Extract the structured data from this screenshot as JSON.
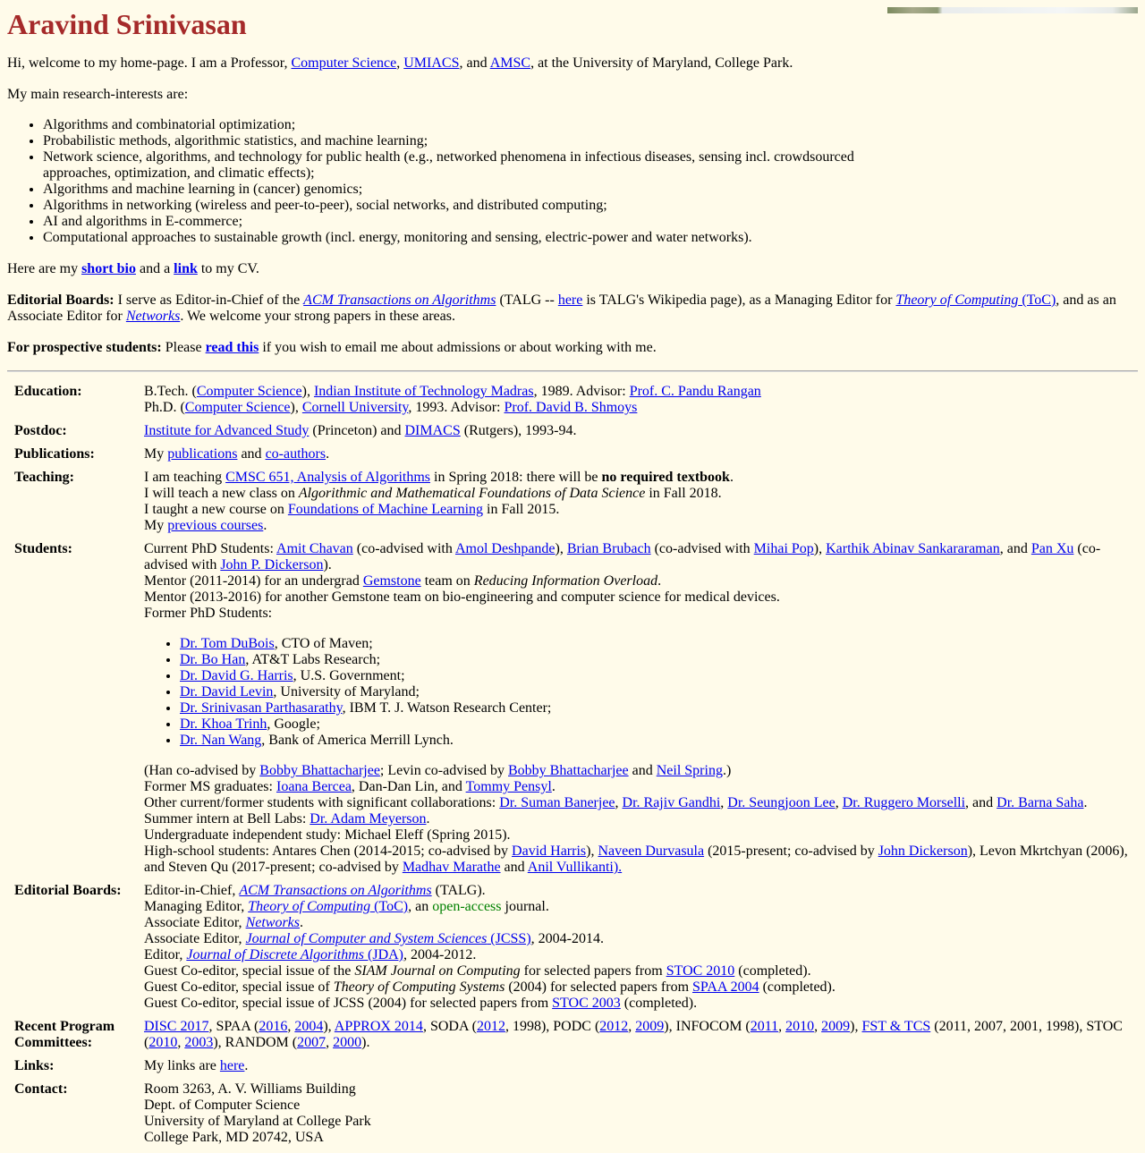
{
  "header": {
    "name": "Aravind Srinivasan"
  },
  "intro": {
    "t1": "Hi, welcome to my home-page. I am a Professor, ",
    "cs": "Computer Science",
    "sep1": ", ",
    "umiacs": "UMIACS",
    "sep2": ", and ",
    "amsc": "AMSC",
    "t2": ", at the University of Maryland, College Park."
  },
  "research": {
    "heading": "My main research-interests are:",
    "items": [
      "Algorithms and combinatorial optimization;",
      "Probabilistic methods, algorithmic statistics, and machine learning;",
      "Network science, algorithms, and technology for public health (e.g., networked phenomena in infectious diseases, sensing incl. crowdsourced approaches, optimization, and climatic effects);",
      "Algorithms and machine learning in (cancer) genomics;",
      "Algorithms in networking (wireless and peer-to-peer), social networks, and distributed computing;",
      "AI and algorithms in E-commerce;",
      "Computational approaches to sustainable growth (incl. energy, monitoring and sensing, electric-power and water networks)."
    ]
  },
  "bio": {
    "t1": "Here are my ",
    "short_bio": "short bio",
    "t2": " and a ",
    "link": "link",
    "t3": " to my CV."
  },
  "editorial_intro": {
    "label": "Editorial Boards:",
    "t1": " I serve as Editor-in-Chief of the ",
    "talg": "ACM Transactions on Algorithms",
    "t2": " (TALG -- ",
    "here": "here",
    "t3": " is TALG's Wikipedia page), as a Managing Editor for ",
    "toc": "Theory of Computing",
    "toc_abbr": " (ToC)",
    "t4": ", and as an Associate Editor for ",
    "networks": "Networks",
    "t5": ". We welcome your strong papers in these areas."
  },
  "prospective": {
    "label": "For prospective students:",
    "t1": " Please ",
    "read_this": "read this",
    "t2": " if you wish to email me about admissions or about working with me."
  },
  "table": {
    "education": {
      "label": "Education:",
      "l1_a": "B.Tech. (",
      "l1_cs": "Computer Science",
      "l1_b": "), ",
      "l1_iit": "Indian Institute of Technology Madras",
      "l1_c": ", 1989. Advisor: ",
      "l1_adv": "Prof. C. Pandu Rangan",
      "l2_a": "Ph.D. (",
      "l2_cs": "Computer Science",
      "l2_b": "), ",
      "l2_cornell": "Cornell University",
      "l2_c": ", 1993. Advisor: ",
      "l2_adv": "Prof. David B. Shmoys"
    },
    "postdoc": {
      "label": "Postdoc:",
      "ias": "Institute for Advanced Study",
      "t1": " (Princeton) and ",
      "dimacs": "DIMACS",
      "t2": " (Rutgers), 1993-94."
    },
    "publications": {
      "label": "Publications:",
      "t1": "My ",
      "pubs": "publications",
      "t2": " and ",
      "coauthors": "co-authors",
      "t3": "."
    },
    "teaching": {
      "label": "Teaching:",
      "l1_a": "I am teaching ",
      "l1_course": "CMSC 651, Analysis of Algorithms",
      "l1_b": " in Spring 2018: there will be ",
      "l1_bold": "no required textbook",
      "l1_c": ".",
      "l2_a": "I will teach a new class on ",
      "l2_em": "Algorithmic and Mathematical Foundations of Data Science",
      "l2_b": " in Fall 2018.",
      "l3_a": "I taught a new course on ",
      "l3_link": "Foundations of Machine Learning",
      "l3_b": " in Fall 2015.",
      "l4_a": "My ",
      "l4_link": "previous courses",
      "l4_b": "."
    },
    "students": {
      "label": "Students:",
      "cur_a": "Current PhD Students: ",
      "amit": "Amit Chavan",
      "cur_b": " (co-advised with ",
      "amol": "Amol Deshpande",
      "cur_c": "), ",
      "brian": "Brian Brubach",
      "cur_d": " (co-advised with ",
      "mihai": "Mihai Pop",
      "cur_e": "), ",
      "karthik": "Karthik Abinav Sankararaman",
      "cur_f": ", and ",
      "panxu": "Pan Xu",
      "cur_g": " (co-advised with ",
      "dickerson": "John P. Dickerson",
      "cur_h": ").",
      "m1_a": "Mentor (2011-2014) for an undergrad ",
      "gemstone": "Gemstone",
      "m1_b": " team on ",
      "m1_em": "Reducing Information Overload",
      "m1_c": ".",
      "m2": "Mentor (2013-2016) for another Gemstone team on bio-engineering and computer science for medical devices.",
      "former": "Former PhD Students:",
      "former_list": [
        {
          "name": "Dr. Tom DuBois",
          "rest": ", CTO of Maven;"
        },
        {
          "name": "Dr. Bo Han",
          "rest": ", AT&T Labs Research;"
        },
        {
          "name": "Dr. David G. Harris",
          "rest": ", U.S. Government;"
        },
        {
          "name": "Dr. David Levin",
          "rest": ", University of Maryland;"
        },
        {
          "name": "Dr. Srinivasan Parthasarathy",
          "rest": ", IBM T. J. Watson Research Center;"
        },
        {
          "name": "Dr. Khoa Trinh",
          "rest": ", Google;"
        },
        {
          "name": "Dr. Nan Wang",
          "rest": ", Bank of America Merrill Lynch."
        }
      ],
      "co_a": "(Han co-advised by ",
      "bobby1": "Bobby Bhattacharjee",
      "co_b": "; Levin co-advised by ",
      "bobby2": "Bobby Bhattacharjee",
      "co_c": " and ",
      "neil": "Neil Spring",
      "co_d": ".)",
      "ms_a": "Former MS graduates: ",
      "ioana": "Ioana Bercea",
      "ms_b": ", Dan-Dan Lin, and ",
      "tommy": "Tommy Pensyl",
      "ms_c": ".",
      "oc_a": "Other current/former students with significant collaborations: ",
      "suman": "Dr. Suman Banerjee",
      "oc_s1": ", ",
      "rajiv": "Dr. Rajiv Gandhi",
      "oc_s2": ", ",
      "seungjoon": "Dr. Seungjoon Lee",
      "oc_s3": ", ",
      "ruggero": "Dr. Ruggero Morselli",
      "oc_b": ", and ",
      "barna": "Dr. Barna Saha",
      "oc_c": ".",
      "si_a": "Summer intern at Bell Labs: ",
      "adam": "Dr. Adam Meyerson",
      "si_b": ".",
      "ug": "Undergraduate independent study: Michael Eleff (Spring 2015).",
      "hs_a": "High-school students: Antares Chen (2014-2015; co-advised by ",
      "dharris": "David Harris",
      "hs_b": "), ",
      "naveen": "Naveen Durvasula",
      "hs_c": " (2015-present; co-advised by ",
      "jdick": "John Dickerson",
      "hs_d": "), Levon Mkrtchyan (2006), and Steven Qu (2017-present; co-advised by ",
      "madhav": "Madhav Marathe",
      "hs_e": " and ",
      "anil": "Anil Vullikanti).",
      "hs_f": ""
    },
    "editorial": {
      "label": "Editorial Boards:",
      "e1_a": "Editor-in-Chief, ",
      "e1_j": "ACM Transactions on Algorithms",
      "e1_b": " (TALG).",
      "e2_a": "Managing Editor, ",
      "e2_j": "Theory of Computing",
      "e2_abbr": " (ToC)",
      "e2_b": ", an ",
      "e2_oa": "open-access",
      "e2_c": " journal.",
      "e3_a": "Associate Editor, ",
      "e3_j": "Networks",
      "e3_b": ".",
      "e4_a": "Associate Editor, ",
      "e4_j": "Journal of Computer and System Sciences",
      "e4_abbr": " (JCSS)",
      "e4_b": ", 2004-2014.",
      "e5_a": "Editor, ",
      "e5_j": "Journal of Discrete Algorithms",
      "e5_abbr": " (JDA)",
      "e5_b": ", 2004-2012.",
      "e6_a": "Guest Co-editor, special issue of the ",
      "e6_em": "SIAM Journal on Computing",
      "e6_b": " for selected papers from ",
      "e6_link": "STOC 2010",
      "e6_c": " (completed).",
      "e7_a": "Guest Co-editor, special issue of ",
      "e7_em": "Theory of Computing Systems",
      "e7_b": " (2004) for selected papers from ",
      "e7_link": "SPAA 2004",
      "e7_c": " (completed).",
      "e8_a": "Guest Co-editor, special issue of JCSS (2004) for selected papers from ",
      "e8_link": "STOC 2003",
      "e8_c": " (completed)."
    },
    "committees": {
      "label": "Recent Program Committees:",
      "disc": "DISC 2017",
      "t1": ", SPAA (",
      "spaa16": "2016",
      "s1": ", ",
      "spaa04": "2004",
      "t2": "), ",
      "approx": "APPROX 2014",
      "t3": ", SODA (",
      "soda12": "2012",
      "t4": ", 1998), PODC (",
      "podc12": "2012",
      "s2": ", ",
      "podc09": "2009",
      "t5": "), INFOCOM (",
      "inf11": "2011",
      "s3": ", ",
      "inf10": "2010",
      "s4": ", ",
      "inf09": "2009",
      "t6": "), ",
      "fst": "FST & TCS",
      "t7": " (2011, 2007, 2001, 1998), STOC (",
      "stoc10": "2010",
      "s5": ", ",
      "stoc03": "2003",
      "t8": "), RANDOM (",
      "rand07": "2007",
      "s6": ", ",
      "rand00": "2000",
      "t9": ")."
    },
    "links": {
      "label": "Links:",
      "t1": "My links are ",
      "here": "here",
      "t2": "."
    },
    "contact": {
      "label": "Contact:",
      "lines": [
        "Room 3263, A. V. Williams Building",
        "Dept. of Computer Science",
        "University of Maryland at College Park",
        "College Park, MD 20742, USA"
      ]
    }
  }
}
